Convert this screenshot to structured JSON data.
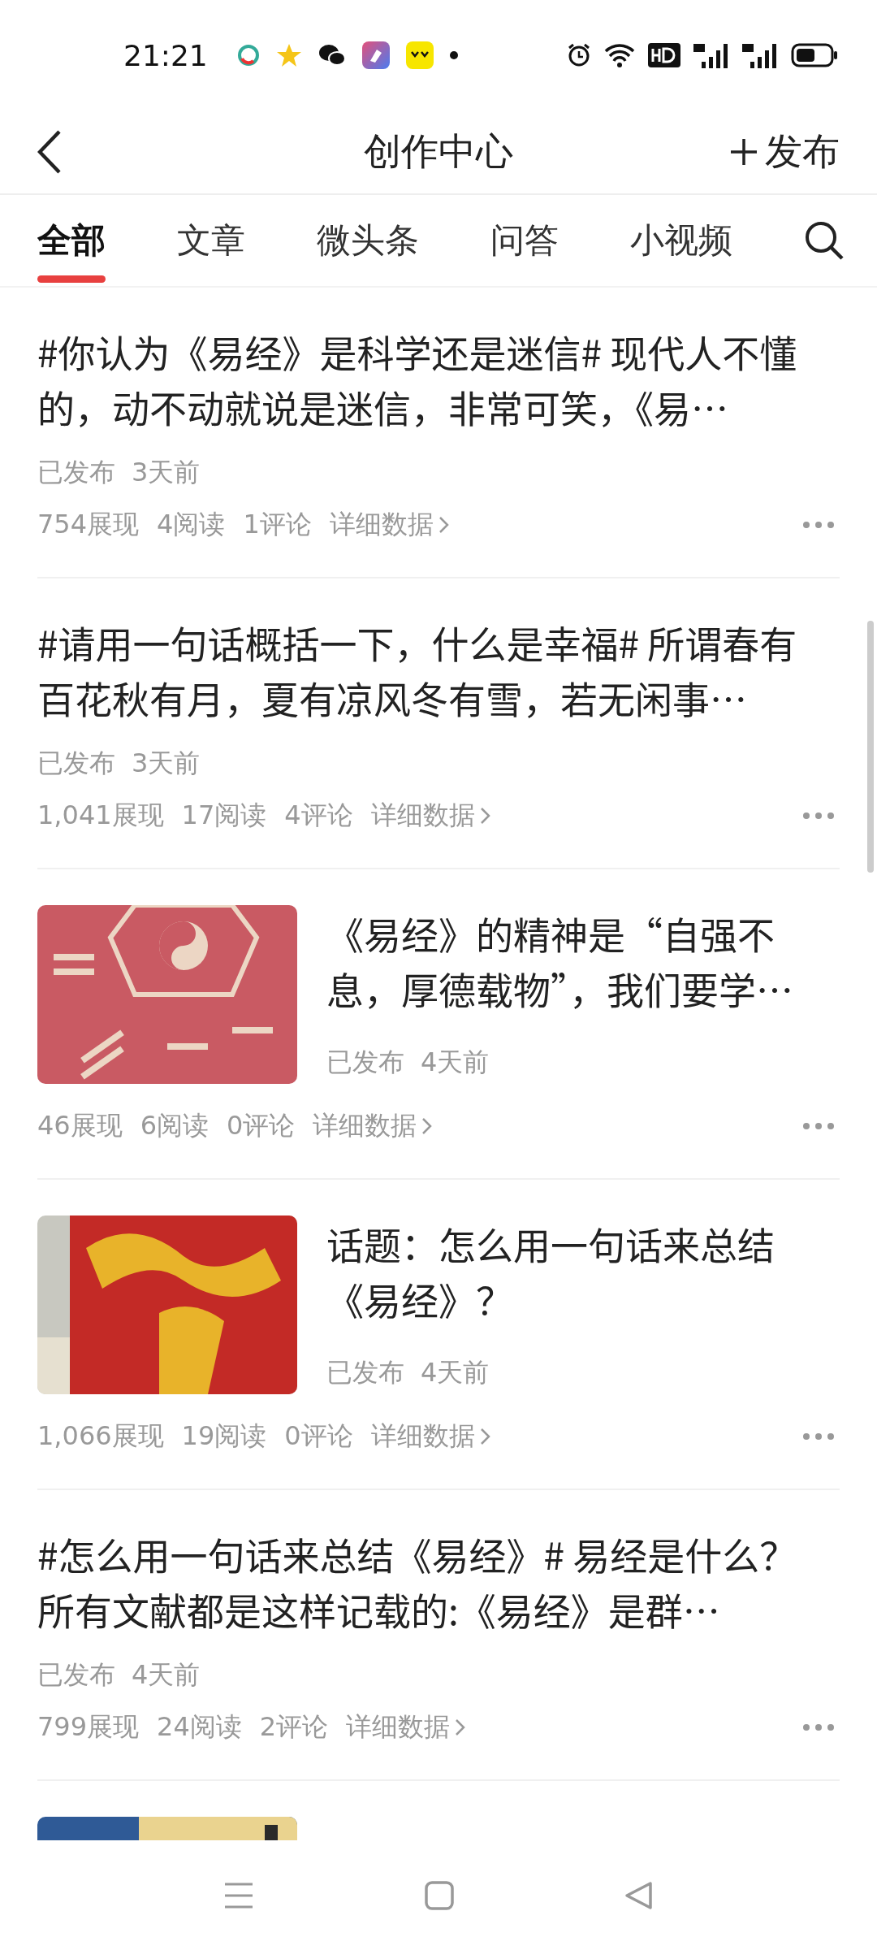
{
  "status_bar": {
    "time": "21:21"
  },
  "header": {
    "title": "创作中心",
    "publish": "发布"
  },
  "tabs": [
    {
      "label": "全部",
      "selected": true
    },
    {
      "label": "文章",
      "selected": false
    },
    {
      "label": "微头条",
      "selected": false
    },
    {
      "label": "问答",
      "selected": false
    },
    {
      "label": "小视频",
      "selected": false
    }
  ],
  "posts": [
    {
      "kind": "text",
      "title": "#你认为《易经》是科学还是迷信# 现代人不懂的，动不动就说是迷信，非常可笑，《易…",
      "status": "已发布",
      "time": "3天前",
      "views": "754展现",
      "reads": "4阅读",
      "comments": "1评论",
      "details": "详细数据"
    },
    {
      "kind": "text",
      "title": "#请用一句话概括一下，什么是幸福# 所谓春有百花秋有月，夏有凉风冬有雪，若无闲事…",
      "status": "已发布",
      "time": "3天前",
      "views": "1,041展现",
      "reads": "17阅读",
      "comments": "4评论",
      "details": "详细数据"
    },
    {
      "kind": "picture",
      "title": "《易经》的精神是“自强不息，厚德载物”，我们要学…",
      "status": "已发布",
      "time": "4天前",
      "views": "46展现",
      "reads": "6阅读",
      "comments": "0评论",
      "details": "详细数据"
    },
    {
      "kind": "picture",
      "title": "话题：怎么用一句话来总结《易经》？",
      "status": "已发布",
      "time": "4天前",
      "views": "1,066展现",
      "reads": "19阅读",
      "comments": "0评论",
      "details": "详细数据"
    },
    {
      "kind": "text",
      "title": "#怎么用一句话来总结《易经》# 易经是什么？所有文献都是这样记载的:《易经》是群…",
      "status": "已发布",
      "time": "4天前",
      "views": "799展现",
      "reads": "24阅读",
      "comments": "2评论",
      "details": "详细数据"
    },
    {
      "kind": "picture"
    }
  ]
}
